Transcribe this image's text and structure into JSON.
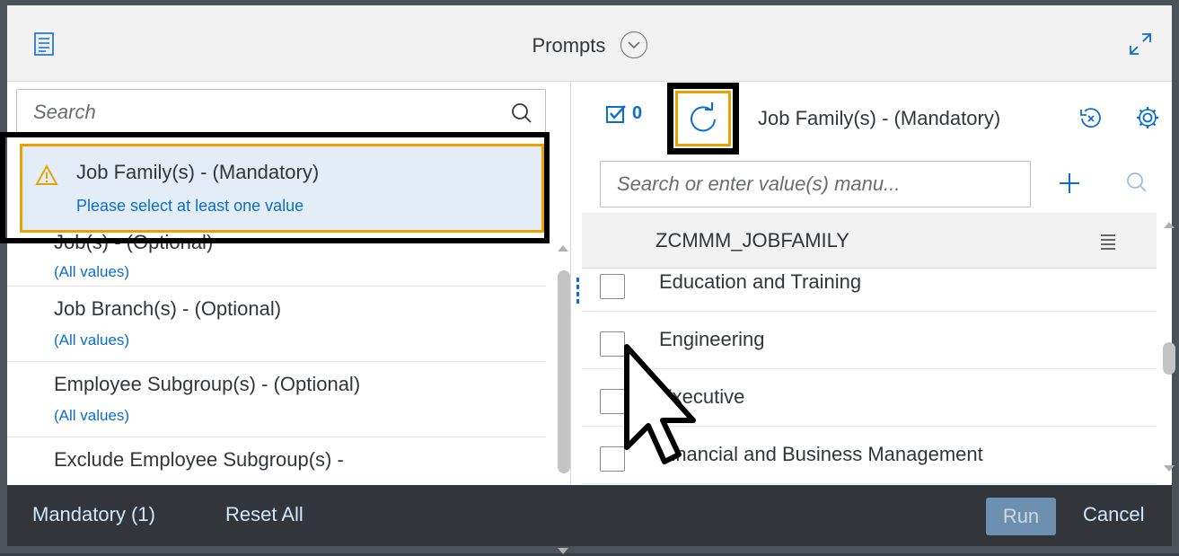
{
  "header": {
    "title": "Prompts"
  },
  "left": {
    "search_placeholder": "Search",
    "items": [
      {
        "name": "Job Family(s) - (Mandatory)",
        "sub": "Please select at least one value",
        "status": "warning",
        "selected": true
      },
      {
        "name": "Job(s) - (Optional)",
        "sub": "(All values)"
      },
      {
        "name": "Job Branch(s) - (Optional)",
        "sub": "(All values)"
      },
      {
        "name": "Employee Subgroup(s) - (Optional)",
        "sub": "(All values)"
      },
      {
        "name": "Exclude Employee Subgroup(s) -",
        "sub": ""
      }
    ]
  },
  "right": {
    "selected_count": "0",
    "title": "Job Family(s) - (Mandatory)",
    "search_placeholder": "Search or enter value(s) manu...",
    "column_header": "ZCMMM_JOBFAMILY",
    "values": [
      {
        "label": "Education and Training",
        "checked": false
      },
      {
        "label": "Engineering",
        "checked": false
      },
      {
        "label": "Executive",
        "checked": false
      },
      {
        "label": "Financial and Business Management",
        "checked": false
      }
    ]
  },
  "footer": {
    "mandatory": "Mandatory (1)",
    "reset": "Reset All",
    "run": "Run",
    "cancel": "Cancel"
  },
  "colors": {
    "accent": "#0a6ed1",
    "warning": "#e9a300",
    "footer_bg": "#32363a",
    "header_bg": "#f2f2f2"
  }
}
